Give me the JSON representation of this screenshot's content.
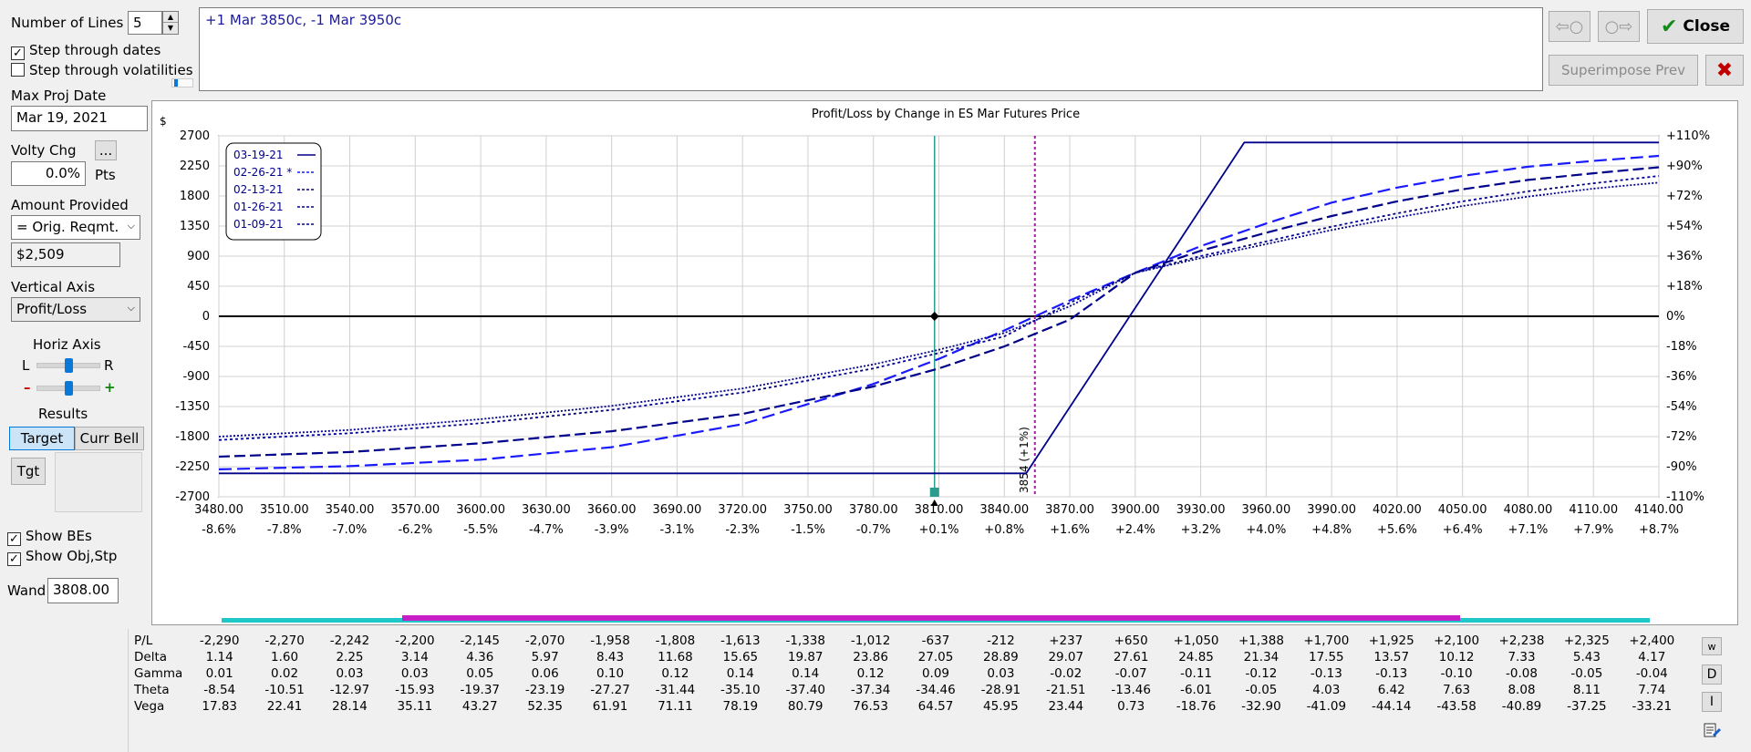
{
  "left_panel": {
    "num_lines_label": "Number of Lines",
    "num_lines_value": "5",
    "step_dates_label": "Step through dates",
    "step_vols_label": "Step through volatilities",
    "max_proj_label": "Max Proj Date",
    "max_proj_value": "Mar 19, 2021",
    "volty_label": "Volty Chg",
    "volty_btn": "...",
    "volty_value": "0.0%",
    "volty_units": "Pts",
    "amount_label": "Amount Provided",
    "amount_select": "= Orig. Reqmt.",
    "amount_value": "$2,509",
    "vert_axis_label": "Vertical Axis",
    "vert_axis_select": "Profit/Loss",
    "horiz_label": "Horiz Axis",
    "horiz_left": "L",
    "horiz_right": "R",
    "horiz_minus": "–",
    "horiz_plus": "+",
    "results_label": "Results",
    "target_btn": "Target",
    "currbell_btn": "Curr Bell",
    "tgt_btn": "Tgt",
    "show_bes_label": "Show BEs",
    "show_obj_label": "Show Obj,Stp",
    "wand_label": "Wand",
    "wand_value": "3808.00"
  },
  "top": {
    "position_text": "+1 Mar 3850c, -1 Mar 3950c",
    "close_btn": "Close",
    "superimpose_btn": "Superimpose Prev",
    "colors": {
      "close_check": "#118a1a",
      "red_x": "#c00000"
    }
  },
  "chart_data": {
    "type": "line",
    "title": "Profit/Loss by Change in ES Mar Futures Price",
    "ylabel": "$",
    "xlim": [
      3480,
      4140
    ],
    "ylim": [
      -2700,
      2700
    ],
    "x_ticks": [
      3480,
      3510,
      3540,
      3570,
      3600,
      3630,
      3660,
      3690,
      3720,
      3750,
      3780,
      3810,
      3840,
      3870,
      3900,
      3930,
      3960,
      3990,
      4020,
      4050,
      4080,
      4110,
      4140
    ],
    "x_tick_labels": [
      "3480.00",
      "3510.00",
      "3540.00",
      "3570.00",
      "3600.00",
      "3630.00",
      "3660.00",
      "3690.00",
      "3720.00",
      "3750.00",
      "3780.00",
      "3810.00",
      "3840.00",
      "3870.00",
      "3900.00",
      "3930.00",
      "3960.00",
      "3990.00",
      "4020.00",
      "4050.00",
      "4080.00",
      "4110.00",
      "4140.00"
    ],
    "x_pct_labels": [
      "-8.6%",
      "-7.8%",
      "-7.0%",
      "-6.2%",
      "-5.5%",
      "-4.7%",
      "-3.9%",
      "-3.1%",
      "-2.3%",
      "-1.5%",
      "-0.7%",
      "+0.1%",
      "+0.8%",
      "+1.6%",
      "+2.4%",
      "+3.2%",
      "+4.0%",
      "+4.8%",
      "+5.6%",
      "+6.4%",
      "+7.1%",
      "+7.9%",
      "+8.7%"
    ],
    "y_ticks": [
      2700,
      2250,
      1800,
      1350,
      900,
      450,
      0,
      -450,
      -900,
      -1350,
      -1800,
      -2250,
      -2700
    ],
    "y_tick_labels": [
      "2700",
      "2250",
      "1800",
      "1350",
      "900",
      "450",
      "0",
      "-450",
      "-900",
      "-1350",
      "-1800",
      "-2250",
      "-2700"
    ],
    "y2_tick_labels": [
      "+110%",
      "+90%",
      "+72%",
      "+54%",
      "+36%",
      "+18%",
      "0%",
      "-18%",
      "-36%",
      "-54%",
      "-72%",
      "-90%",
      "-110%"
    ],
    "legend": [
      "03-19-21",
      "02-26-21 *",
      "02-13-21",
      "01-26-21",
      "01-09-21"
    ],
    "legend_placement": "top-left",
    "grid": true,
    "current_price": 3808,
    "breakeven_price": 3854,
    "breakeven_label": "3854 (+1%)",
    "colors": {
      "line": "#00008b",
      "line_bright": "#1a1aff",
      "current": "#2a9d8f",
      "breakeven": "#a020a0",
      "cyan_bar": "#1ec8c8",
      "magenta_bar": "#c81ec8"
    },
    "series": [
      {
        "name": "03-19-21",
        "x": [
          3480,
          3850,
          3950,
          4140
        ],
        "y": [
          -2350,
          -2350,
          2600,
          2600
        ]
      },
      {
        "name": "02-26-21 *",
        "x": [
          3480,
          3540,
          3600,
          3660,
          3720,
          3780,
          3810,
          3840,
          3870,
          3900,
          3930,
          3960,
          3990,
          4020,
          4050,
          4080,
          4110,
          4140
        ],
        "y": [
          -2290,
          -2242,
          -2145,
          -1958,
          -1613,
          -1012,
          -637,
          -212,
          237,
          650,
          1050,
          1388,
          1700,
          1925,
          2100,
          2238,
          2325,
          2400
        ]
      },
      {
        "name": "02-13-21",
        "x": [
          3480,
          3540,
          3600,
          3660,
          3720,
          3780,
          3810,
          3840,
          3870,
          3900,
          3930,
          3960,
          3990,
          4020,
          4050,
          4080,
          4110,
          4140
        ],
        "y": [
          -2100,
          -2030,
          -1900,
          -1720,
          -1460,
          -1050,
          -780,
          -450,
          -50,
          650,
          980,
          1250,
          1500,
          1720,
          1900,
          2040,
          2140,
          2230
        ]
      },
      {
        "name": "01-26-21",
        "x": [
          3480,
          3540,
          3600,
          3660,
          3720,
          3780,
          3810,
          3840,
          3870,
          3900,
          3930,
          3960,
          3990,
          4020,
          4050,
          4080,
          4110,
          4140
        ],
        "y": [
          -1850,
          -1750,
          -1600,
          -1400,
          -1140,
          -780,
          -550,
          -300,
          200,
          650,
          900,
          1120,
          1340,
          1540,
          1720,
          1870,
          1990,
          2100
        ]
      },
      {
        "name": "01-09-21",
        "x": [
          3480,
          3540,
          3600,
          3660,
          3720,
          3780,
          3810,
          3840,
          3870,
          3900,
          3930,
          3960,
          3990,
          4020,
          4050,
          4080,
          4110,
          4140
        ],
        "y": [
          -1800,
          -1700,
          -1540,
          -1340,
          -1080,
          -720,
          -500,
          -250,
          150,
          650,
          870,
          1080,
          1290,
          1480,
          1650,
          1790,
          1910,
          2000
        ]
      }
    ]
  },
  "greeks": {
    "rows": [
      {
        "name": "P/L",
        "values": [
          "-2,290",
          "-2,270",
          "-2,242",
          "-2,200",
          "-2,145",
          "-2,070",
          "-1,958",
          "-1,808",
          "-1,613",
          "-1,338",
          "-1,012",
          "-637",
          "-212",
          "+237",
          "+650",
          "+1,050",
          "+1,388",
          "+1,700",
          "+1,925",
          "+2,100",
          "+2,238",
          "+2,325",
          "+2,400"
        ]
      },
      {
        "name": "Delta",
        "values": [
          "1.14",
          "1.60",
          "2.25",
          "3.14",
          "4.36",
          "5.97",
          "8.43",
          "11.68",
          "15.65",
          "19.87",
          "23.86",
          "27.05",
          "28.89",
          "29.07",
          "27.61",
          "24.85",
          "21.34",
          "17.55",
          "13.57",
          "10.12",
          "7.33",
          "5.43",
          "4.17"
        ]
      },
      {
        "name": "Gamma",
        "values": [
          "0.01",
          "0.02",
          "0.03",
          "0.03",
          "0.05",
          "0.06",
          "0.10",
          "0.12",
          "0.14",
          "0.14",
          "0.12",
          "0.09",
          "0.03",
          "-0.02",
          "-0.07",
          "-0.11",
          "-0.12",
          "-0.13",
          "-0.13",
          "-0.10",
          "-0.08",
          "-0.05",
          "-0.04"
        ]
      },
      {
        "name": "Theta",
        "values": [
          "-8.54",
          "-10.51",
          "-12.97",
          "-15.93",
          "-19.37",
          "-23.19",
          "-27.27",
          "-31.44",
          "-35.10",
          "-37.40",
          "-37.34",
          "-34.46",
          "-28.91",
          "-21.51",
          "-13.46",
          "-6.01",
          "-0.05",
          "4.03",
          "6.42",
          "7.63",
          "8.08",
          "8.11",
          "7.74"
        ]
      },
      {
        "name": "Vega",
        "values": [
          "17.83",
          "22.41",
          "28.14",
          "35.11",
          "43.27",
          "52.35",
          "61.91",
          "71.11",
          "78.19",
          "80.79",
          "76.53",
          "64.57",
          "45.95",
          "23.44",
          "0.73",
          "-18.76",
          "-32.90",
          "-41.09",
          "-44.14",
          "-43.58",
          "-40.89",
          "-37.25",
          "-33.21"
        ]
      }
    ],
    "side_buttons": [
      "w",
      "D",
      "I"
    ]
  }
}
